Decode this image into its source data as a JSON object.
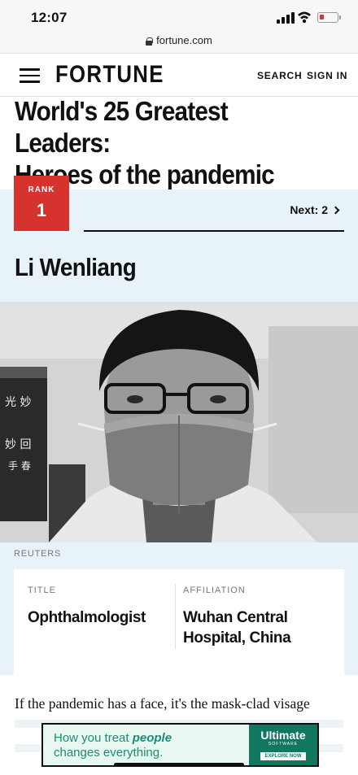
{
  "status_bar": {
    "time": "12:07",
    "battery_color": "#e2312c"
  },
  "browser": {
    "url": "fortune.com",
    "lock_icon": "lock-icon"
  },
  "site_header": {
    "logo": "FORTUNE",
    "search_label": "SEARCH",
    "signin_label": "SIGN IN",
    "menu_icon": "hamburger-menu-icon"
  },
  "article": {
    "headline_line1": "World's 25 Greatest Leaders:",
    "headline_line2": "Heroes of the pandemic",
    "rank_label": "RANK",
    "rank_number": "1",
    "next_label": "Next: 2",
    "person_name": "Li Wenliang",
    "photo_credit": "REUTERS",
    "fields": [
      {
        "label": "TITLE",
        "value": "Ophthalmologist"
      },
      {
        "label": "AFFILIATION",
        "value": "Wuhan Central Hospital, China"
      }
    ],
    "body_first_line": "If the pandemic has a face, it's the mask-clad visage"
  },
  "ad": {
    "text_line1_a": "How you treat ",
    "text_line1_b": "people",
    "text_line2": "changes everything.",
    "brand": "Ultimate",
    "brand_sub": "SOFTWARE",
    "cta": "EXPLORE NOW"
  },
  "colors": {
    "accent_red": "#d6332f",
    "band_blue": "#e7f3f8",
    "ad_green": "#11785f"
  }
}
